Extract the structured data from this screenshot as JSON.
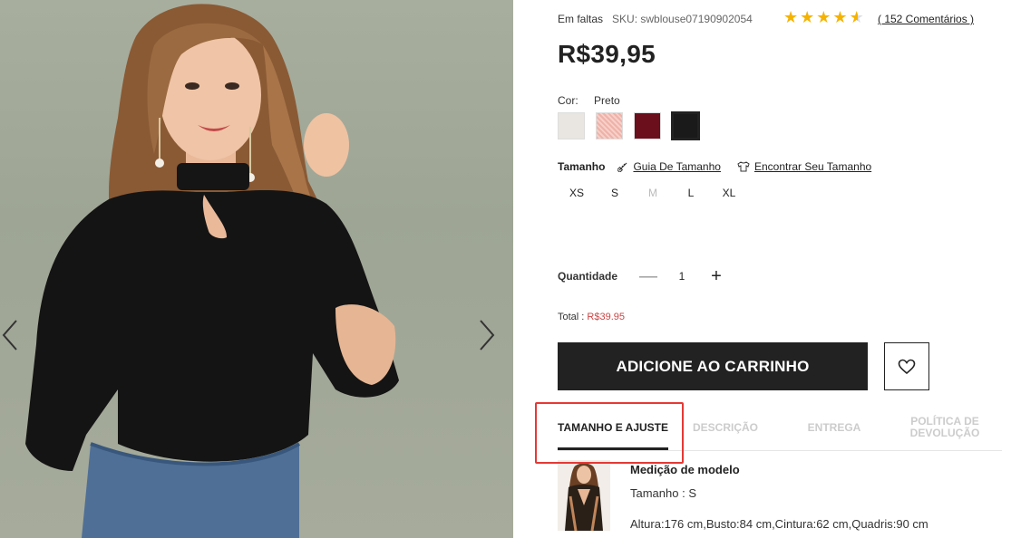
{
  "product": {
    "stock_status": "Em faltas",
    "sku": "SKU: swblouse07190902054",
    "rating": 4.5,
    "reviews_label": "( 152 Comentários )",
    "price": "R$39,95"
  },
  "color": {
    "label": "Cor:",
    "selected": "Preto",
    "swatches": [
      {
        "name": "white",
        "hex": "#e9e6e1"
      },
      {
        "name": "pink",
        "hex": "#eeb2a8"
      },
      {
        "name": "burgundy",
        "hex": "#6b0f1c"
      },
      {
        "name": "black",
        "hex": "#1a1a1a"
      }
    ]
  },
  "size": {
    "label": "Tamanho",
    "guide_link": "Guia De Tamanho",
    "find_link": "Encontrar Seu Tamanho",
    "options": [
      {
        "label": "XS",
        "available": true
      },
      {
        "label": "S",
        "available": true
      },
      {
        "label": "M",
        "available": false
      },
      {
        "label": "L",
        "available": true
      },
      {
        "label": "XL",
        "available": true
      }
    ]
  },
  "quantity": {
    "label": "Quantidade",
    "minus": "—",
    "value": "1",
    "plus": "+"
  },
  "total": {
    "label": "Total :",
    "amount": "R$39.95"
  },
  "actions": {
    "add_to_cart": "ADICIONE AO CARRINHO"
  },
  "tabs": [
    {
      "label": "TAMANHO E AJUSTE",
      "active": true
    },
    {
      "label": "DESCRIÇÃO",
      "active": false
    },
    {
      "label": "ENTREGA",
      "active": false
    },
    {
      "label": "POLÍTICA DE DEVOLUÇÃO",
      "active": false
    }
  ],
  "model": {
    "title": "Medição de modelo",
    "size": "Tamanho : S",
    "measurements": "Altura:176 cm,Busto:84 cm,Cintura:62 cm,Quadris:90 cm"
  },
  "colors": {
    "accent": "#222222",
    "highlight": "#e53935",
    "star": "#f5b301",
    "price_total": "#cc4444"
  }
}
